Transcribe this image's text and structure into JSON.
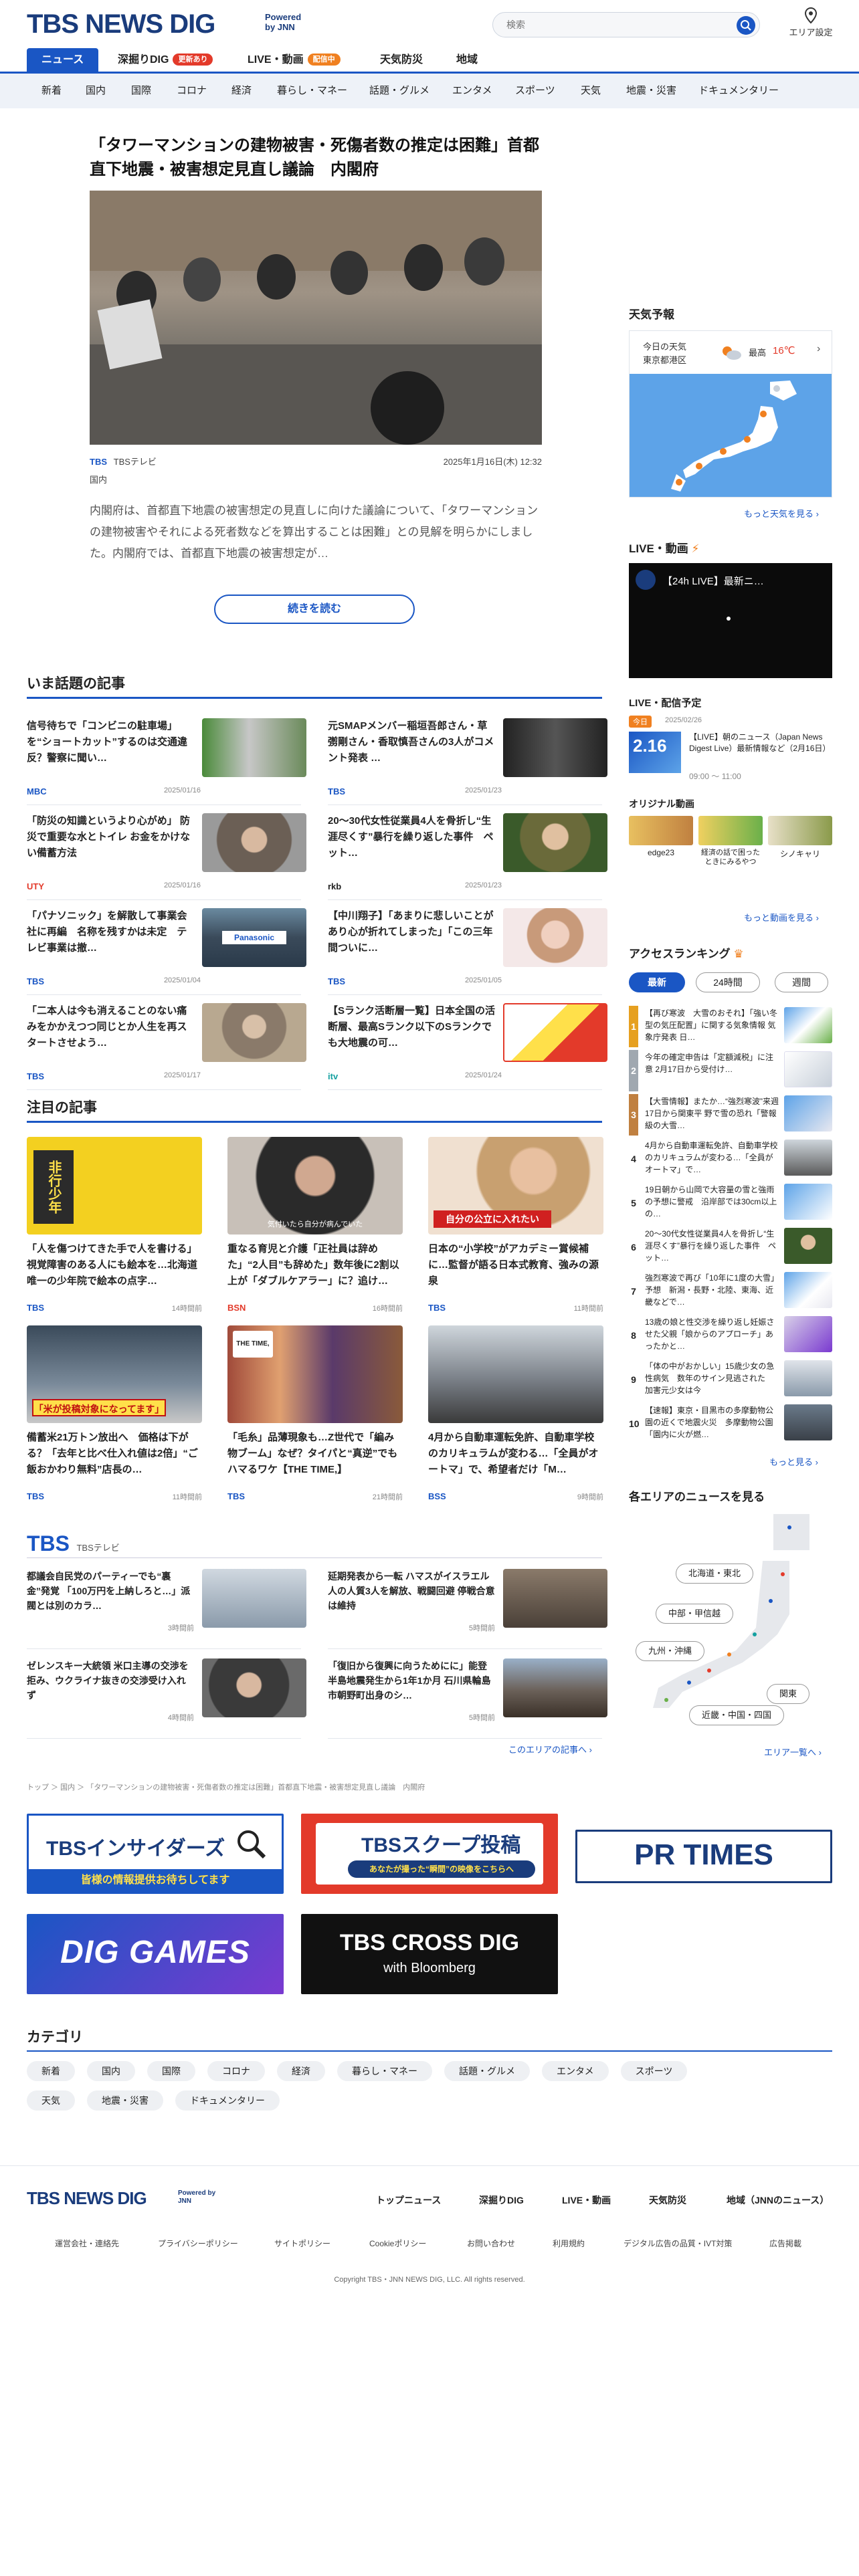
{
  "header": {
    "logo": "TBS NEWS DIG",
    "powered": "Powered by JNN",
    "search_placeholder": "検索",
    "area_setting": "エリア設定"
  },
  "nav_main": [
    {
      "label": "ニュース"
    },
    {
      "label": "深掘りDIG",
      "badge": "更新あり"
    },
    {
      "label": "LIVE・動画",
      "badge": "配信中"
    },
    {
      "label": "天気防災"
    },
    {
      "label": "地域"
    }
  ],
  "nav_sub": [
    "新着",
    "国内",
    "国際",
    "コロナ",
    "経済",
    "暮らし・マネー",
    "話題・グルメ",
    "エンタメ",
    "スポーツ",
    "天気",
    "地震・災害",
    "ドキュメンタリー"
  ],
  "hero": {
    "title": "「タワーマンションの建物被害・死傷者数の推定は困難」首都直下地震・被害想定見直し議論　内閣府",
    "source": "TBS",
    "source_full": "TBSテレビ",
    "date": "2025年1月16日(木) 12:32",
    "category": "国内",
    "summary": "内閣府は、首都直下地震の被害想定の見直しに向けた議論について、「タワーマンションの建物被害やそれによる死者数などを算出することは困難」との見解を明らかにしました。内閣府では、首都直下地震の被害想定が…",
    "read_more": "続きを読む"
  },
  "trending": {
    "heading": "いま話題の記事",
    "items": [
      {
        "title": "信号待ちで「コンビニの駐車場」を“ショートカット”するのは交通違反？警察に聞い…",
        "source": "MBC",
        "date": "2025/01/16"
      },
      {
        "title": "元SMAPメンバー稲垣吾郎さん・草彅剛さん・香取慎吾さんの3人がコメント発表 …",
        "source": "TBS",
        "date": "2025/01/23"
      },
      {
        "title": "「防災の知識というより心がめ」 防災で重要な水とトイレ お金をかけない備蓄方法",
        "source": "UTY",
        "date": "2025/01/16"
      },
      {
        "title": "20〜30代女性従業員4人を骨折し“生涯尽くす”暴行を繰り返した事件　ペット…",
        "source": "rkb",
        "date": "2025/01/23"
      },
      {
        "title": "「パナソニック」を解散して事業会社に再編　名称を残すかは未定　テレビ事業は撤…",
        "source": "TBS",
        "date": "2025/01/04"
      },
      {
        "title": "【中川翔子】「あまりに悲しいことがあり心が折れてしまった」「この三年間ついに…",
        "source": "TBS",
        "date": "2025/01/05"
      },
      {
        "title": "「二本人は今も消えることのない痛みをかかえつつ同じとか人生を再スタートさせよう…",
        "source": "TBS",
        "date": "2025/01/17"
      },
      {
        "title": "【Sランク活断層一覧】日本全国の活断層、最高Sランク以下のSランクでも大地震の可…",
        "source": "itv",
        "date": "2025/01/24"
      }
    ]
  },
  "featured": {
    "heading": "注目の記事",
    "items": [
      {
        "title": "「人を傷つけてきた手で人を書ける」視覚障害のある人にも絵本を…北海道唯一の少年院で絵本の点字…",
        "source": "TBS",
        "date": "14時間前",
        "thumb_text": "非行少年"
      },
      {
        "title": "重なる育児と介護「正社員は辞めた」“2人目”も辞めた」数年後に2割以上が「ダブルケアラー」に？追け…",
        "source": "BSN",
        "date": "16時間前",
        "thumb_text": "気付いたら自分が病んでいた"
      },
      {
        "title": "日本の“小学校”がアカデミー賞候補に…監督が語る日本式教育、強みの源泉",
        "source": "TBS",
        "date": "11時間前",
        "thumb_text": "自分の公立に入れたい"
      },
      {
        "title": "備蓄米21万トン放出へ　価格は下がる？「去年と比べ仕入れ値は2倍」“ご飯おかわり無料”店長の…",
        "source": "TBS",
        "date": "11時間前",
        "thumb_text": "「米が投稿対象になってます」"
      },
      {
        "title": "「毛糸」品薄現象も…Z世代で「編み物ブーム」なぜ？タイパと“真逆”でもハマるワケ【THE TIME,】",
        "source": "TBS",
        "date": "21時間前",
        "thumb_text": "THE TIME,"
      },
      {
        "title": "4月から自動車運転免許、自動車学校のカリキュラムが変わる…「全員がオートマ」で、希望者だけ「M…",
        "source": "BSS",
        "date": "9時間前",
        "thumb_text": ""
      }
    ]
  },
  "tbs_block": {
    "logo": "TBS",
    "sub": "TBSテレビ",
    "items": [
      {
        "title": "都議会自民党のパーティーでも“裏金”発覚 「100万円を上納しろと…」派閥とは別のカラ…",
        "date": "3時間前"
      },
      {
        "title": "延期発表から一転 ハマスがイスラエル人の人質3人を解放、戦闘回避 停戦合意は維持",
        "date": "5時間前"
      },
      {
        "title": "ゼレンスキー大統領 米口主導の交渉を拒み、ウクライナ抜きの交渉受け入れず",
        "date": "4時間前"
      },
      {
        "title": "「復旧から復興に向うためにに」能登半島地震発生から1年1か月 石川県輪島市朝野町出身のシ…",
        "date": "5時間前"
      }
    ],
    "area_more": "このエリアの記事へ"
  },
  "breadcrumb": "トップ ＞ 国内 ＞ 「タワーマンションの建物被害・死傷者数の推定は困難」首都直下地震・被害想定見直し議論　内閣府",
  "banners": [
    {
      "title": "TBSインサイダーズ",
      "sub": "皆様の情報提供お待ちしてます"
    },
    {
      "title": "TBSスクープ投稿",
      "sub": "あなたが撮った“瞬間”の映像をこちらへ"
    },
    {
      "title": "PR TIMES",
      "sub": ""
    },
    {
      "title": "DIG GAMES",
      "sub": ""
    },
    {
      "title": "TBS CROSS DIG",
      "sub": "with Bloomberg"
    }
  ],
  "categories": {
    "heading": "カテゴリ",
    "items": [
      "新着",
      "国内",
      "国際",
      "コロナ",
      "経済",
      "暮らし・マネー",
      "話題・グルメ",
      "エンタメ",
      "スポーツ",
      "天気",
      "地震・災害",
      "ドキュメンタリー"
    ]
  },
  "sidebar": {
    "weather_heading": "天気予報",
    "weather_today": "今日の天気",
    "weather_place": "東京都港区",
    "weather_max_label": "最高",
    "weather_max": "16℃",
    "weather_more": "もっと天気を見る",
    "live_heading": "LIVE・動画",
    "live_title": "【24h LIVE】最新ニ…",
    "schedule_heading": "LIVE・配信予定",
    "schedule_badge": "今日",
    "schedule_date_label": "2025/02/26",
    "schedule_day": "2.16",
    "schedule_title": "【LIVE】朝のニュース（Japan News Digest Live）最新情報など（2月16日）",
    "schedule_time": "09:00 〜 11:00",
    "original_heading": "オリジナル動画",
    "originals": [
      "edge23",
      "経済の話で困ったときにみるやつ",
      "シノキャリ"
    ],
    "video_more": "もっと動画を見る",
    "ranking_heading": "アクセスランキング",
    "ranking_tabs": [
      "最新",
      "24時間",
      "週間"
    ],
    "ranking": [
      "【再び寒波　大雪のおそれ】「強い冬型の気圧配置」に関する気象情報 気象庁発表 日…",
      "今年の確定申告は「定額減税」に注意 2月17日から受付け…",
      "【大雪情報】またか…“強烈寒波”来週17日から関東平 野で雪の恐れ「警報級の大雪…",
      "4月から自動車運転免許、自動車学校のカリキュラムが変わる…「全員がオートマ」で…",
      "19日朝から山岡で大容量の雪と強雨の予想に警戒　沿岸部では30cm以上の…",
      "20〜30代女性従業員4人を骨折し“生涯尽くす”暴行を繰り返した事件　ペット…",
      "強烈寒波で再び「10年に1度の大雪」予想　新潟・長野・北陸、東海、近畿などで…",
      "13歳の娘と性交渉を繰り返し妊娠させた父親「娘からのアプローチ」あったかと…",
      "「体の中がおかしい」15歳少女の急性病気　数年のサイン見逃された　加害元少女は今",
      "【速報】東京・目黒市の多摩動物公園の近くで地震火災　多摩動物公園「園内に火が燃…"
    ],
    "ranking_more": "もっと見る",
    "area_heading": "各エリアのニュースを見る",
    "areas": [
      "北海道・東北",
      "中部・甲信越",
      "九州・沖縄",
      "関東",
      "近畿・中国・四国"
    ],
    "area_more": "エリア一覧へ"
  },
  "footer": {
    "logo": "TBS NEWS DIG",
    "powered": "Powered by JNN",
    "nav": [
      "トップニュース",
      "深掘りDIG",
      "LIVE・動画",
      "天気防災",
      "地域（JNNのニュース）"
    ],
    "sub": [
      "運営会社・連絡先",
      "プライバシーポリシー",
      "サイトポリシー",
      "Cookieポリシー",
      "お問い合わせ",
      "利用規約",
      "デジタル広告の品質・IVT対策",
      "広告掲載"
    ],
    "copyright": "Copyright TBS・JNN NEWS DIG, LLC. All rights reserved."
  },
  "colors": {
    "brand": "#1a3c7c",
    "accent": "#1a56c4",
    "rank_orange": "#f08020",
    "live_red": "#e33a2a"
  }
}
